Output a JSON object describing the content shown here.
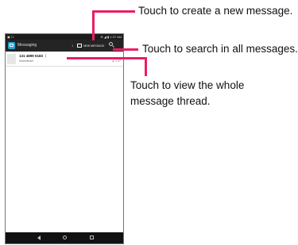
{
  "status_bar": {
    "left_icons": "▣ ☐",
    "right_text": "⊕ ◢ ▮ 1:37 AM"
  },
  "app_bar": {
    "title": "Messaging",
    "thread_count": "1",
    "new_message_label": "NEW MESSAGE"
  },
  "threads": [
    {
      "name": "131 4899 5183 ⋮",
      "preview": "Sweetheart",
      "time": "▲ 1:37"
    }
  ],
  "callouts": {
    "new_message": "Touch to create a new message.",
    "search": "Touch to search in all messages.",
    "thread_line1": "Touch to view the whole",
    "thread_line2": "message thread."
  },
  "colors": {
    "accent": "#ea1e63",
    "app_icon": "#27a4d8",
    "app_bar": "#242424",
    "status_bar": "#1b1b1b"
  }
}
